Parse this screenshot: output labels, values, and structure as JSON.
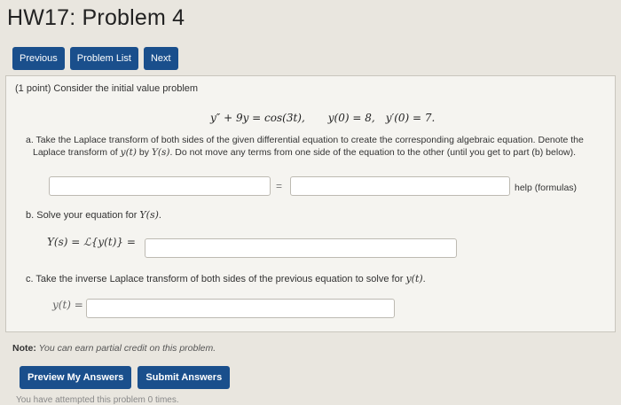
{
  "page": {
    "title": "HW17: Problem 4"
  },
  "nav": {
    "previous": "Previous",
    "problem_list": "Problem List",
    "next": "Next"
  },
  "problem": {
    "intro": "(1 point) Consider the initial value problem",
    "equation": {
      "ode": "y″ + 9y = cos(3t),",
      "ic1": "y(0) = 8,",
      "ic2": "y′(0) = 7."
    },
    "part_a": {
      "line1_start": "a. Take the Laplace transform of both sides of the given differential equation to create the corresponding algebraic equation. Denote the",
      "line2_a": "Laplace transform of ",
      "var_yt": "y(t)",
      "line2_b": " by ",
      "var_Ys": "Y(s)",
      "line2_c": ". Do not move any terms from one side of the equation to the other (until you get to part (b) below).",
      "lhs_value": "",
      "rhs_value": "",
      "equals": "=",
      "help": "help (formulas)"
    },
    "part_b": {
      "text": "b. Solve your equation for ",
      "var": "Y(s)",
      "period": ".",
      "label": "Y(s) = ℒ{y(t)} =",
      "value": ""
    },
    "part_c": {
      "text": "c. Take the inverse Laplace transform of both sides of the previous equation to solve for ",
      "var": "y(t)",
      "period": ".",
      "label": "y(t) =",
      "value": ""
    }
  },
  "note": {
    "label": "Note:",
    "text": " You can earn partial credit on this problem."
  },
  "actions": {
    "preview": "Preview My Answers",
    "submit": "Submit Answers"
  },
  "status": {
    "attempts": "You have attempted this problem 0 times."
  }
}
